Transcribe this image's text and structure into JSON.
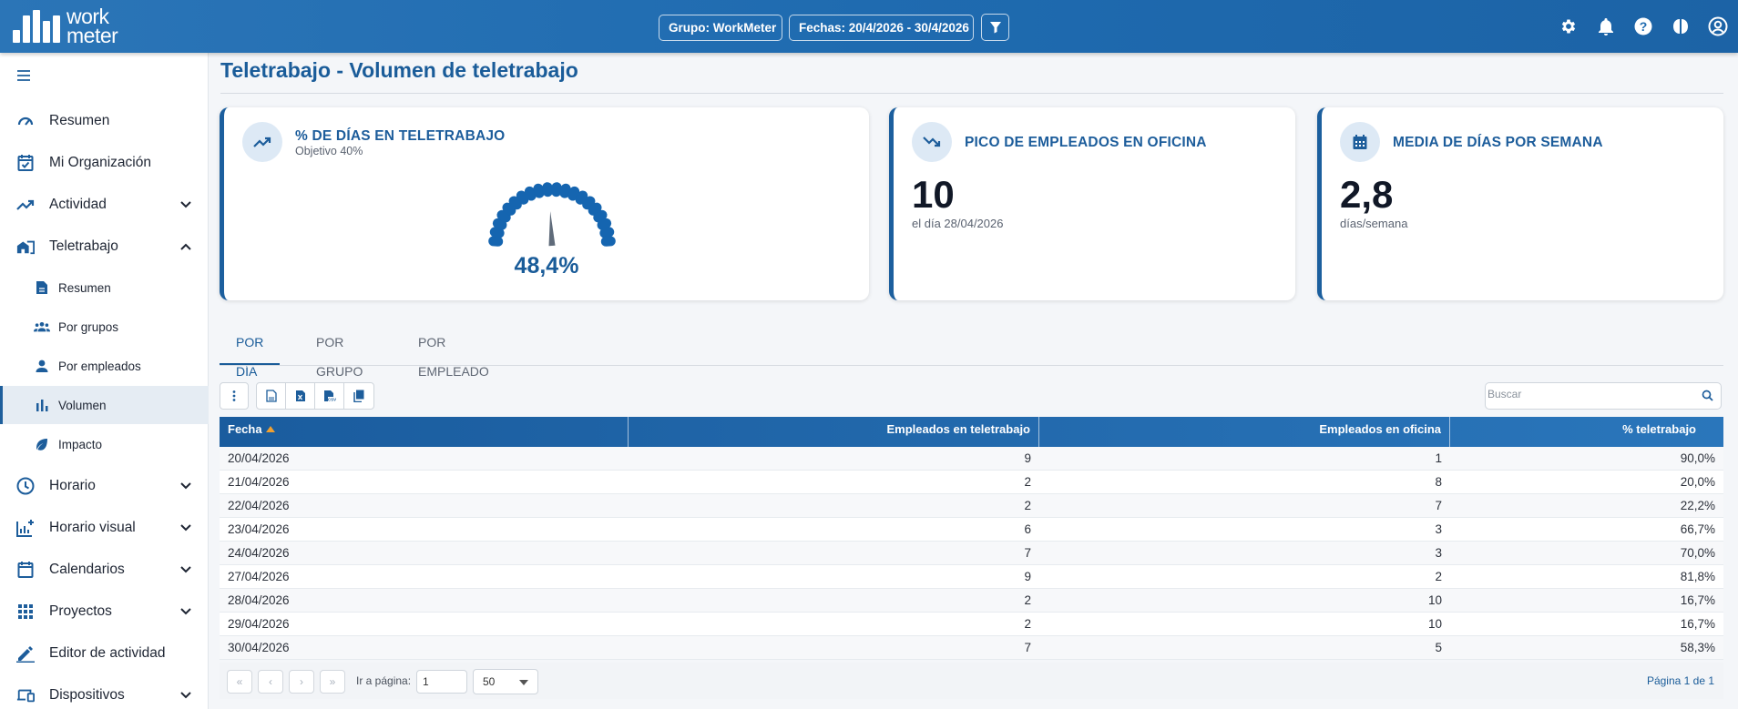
{
  "brand": {
    "logo_text_line1": "work",
    "logo_text_line2": "meter"
  },
  "header": {
    "group_pill": "Grupo: WorkMeter",
    "dates_pill": "Fechas: 20/4/2026 - 30/4/2026"
  },
  "sidebar": {
    "items": [
      {
        "label": "Resumen",
        "icon": "gauge-icon"
      },
      {
        "label": "Mi Organización",
        "icon": "calendar-check-icon"
      },
      {
        "label": "Actividad",
        "icon": "trending-up-icon"
      },
      {
        "label": "Teletrabajo",
        "icon": "home-work-icon"
      },
      {
        "label": "Horario",
        "icon": "clock-icon"
      },
      {
        "label": "Horario visual",
        "icon": "chart-plus-icon"
      },
      {
        "label": "Calendarios",
        "icon": "calendar-icon"
      },
      {
        "label": "Proyectos",
        "icon": "grid-dots-icon"
      },
      {
        "label": "Editor de actividad",
        "icon": "pencil-icon"
      },
      {
        "label": "Dispositivos",
        "icon": "devices-icon"
      }
    ],
    "subitems": [
      {
        "label": "Resumen",
        "icon": "document-icon"
      },
      {
        "label": "Por grupos",
        "icon": "groups-icon"
      },
      {
        "label": "Por empleados",
        "icon": "person-icon"
      },
      {
        "label": "Volumen",
        "icon": "bar-chart-icon"
      },
      {
        "label": "Impacto",
        "icon": "leaf-icon"
      }
    ]
  },
  "page": {
    "title": "Teletrabajo - Volumen de teletrabajo"
  },
  "cards": {
    "remote_pct": {
      "title": "% DE DÍAS EN TELETRABAJO",
      "subtitle": "Objetivo 40%",
      "value_label": "48,4%",
      "value": 48.4
    },
    "office_peak": {
      "title": "PICO DE EMPLEADOS EN OFICINA",
      "value": "10",
      "subtitle": "el día 28/04/2026"
    },
    "avg_days": {
      "title": "MEDIA DE DÍAS POR SEMANA",
      "value": "2,8",
      "subtitle": "días/semana"
    }
  },
  "tabs": [
    "POR DÍA",
    "POR GRUPO",
    "POR EMPLEADO"
  ],
  "search": {
    "placeholder": "Buscar"
  },
  "table": {
    "headers": [
      "Fecha",
      "Empleados en teletrabajo",
      "Empleados en oficina",
      "% teletrabajo"
    ],
    "rows": [
      [
        "20/04/2026",
        "9",
        "1",
        "90,0%"
      ],
      [
        "21/04/2026",
        "2",
        "8",
        "20,0%"
      ],
      [
        "22/04/2026",
        "2",
        "7",
        "22,2%"
      ],
      [
        "23/04/2026",
        "6",
        "3",
        "66,7%"
      ],
      [
        "24/04/2026",
        "7",
        "3",
        "70,0%"
      ],
      [
        "27/04/2026",
        "9",
        "2",
        "81,8%"
      ],
      [
        "28/04/2026",
        "2",
        "10",
        "16,7%"
      ],
      [
        "29/04/2026",
        "2",
        "10",
        "16,7%"
      ],
      [
        "30/04/2026",
        "7",
        "5",
        "58,3%"
      ]
    ]
  },
  "pager": {
    "goto_label": "Ir a página:",
    "goto_value": "1",
    "page_size": "50",
    "page_info": "Página 1 de 1"
  },
  "colors": {
    "brand_blue": "#1d5d9b",
    "gauge_blue": "#1565b0"
  }
}
